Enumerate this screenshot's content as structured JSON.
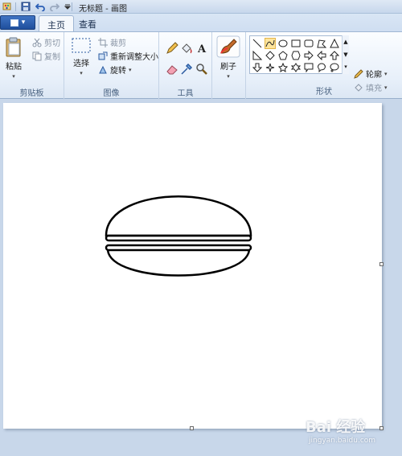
{
  "window": {
    "title": "无标题 - 画图"
  },
  "quick_access": {
    "icons": [
      "paint-app-icon",
      "save-icon",
      "undo-icon",
      "redo-icon",
      "customize-dropdown-icon"
    ]
  },
  "tabs": [
    {
      "label": "主页",
      "active": true
    },
    {
      "label": "查看",
      "active": false
    }
  ],
  "ribbon": {
    "clipboard": {
      "label": "剪贴板",
      "paste": "粘贴",
      "cut": "剪切",
      "copy": "复制"
    },
    "image": {
      "label": "图像",
      "select": "选择",
      "crop": "裁剪",
      "resize": "重新调整大小",
      "rotate": "旋转"
    },
    "tools": {
      "label": "工具"
    },
    "brushes": {
      "label": "刷子"
    },
    "shapes": {
      "label": "形状",
      "outline": "轮廓",
      "fill": "填充"
    }
  },
  "watermark": {
    "text": "Bai 经验",
    "sub": "jingyan.baidu.com"
  },
  "colors": {
    "accent": "#1f4f9c",
    "canvas": "#ffffff",
    "workspace": "#c8d7ea"
  }
}
